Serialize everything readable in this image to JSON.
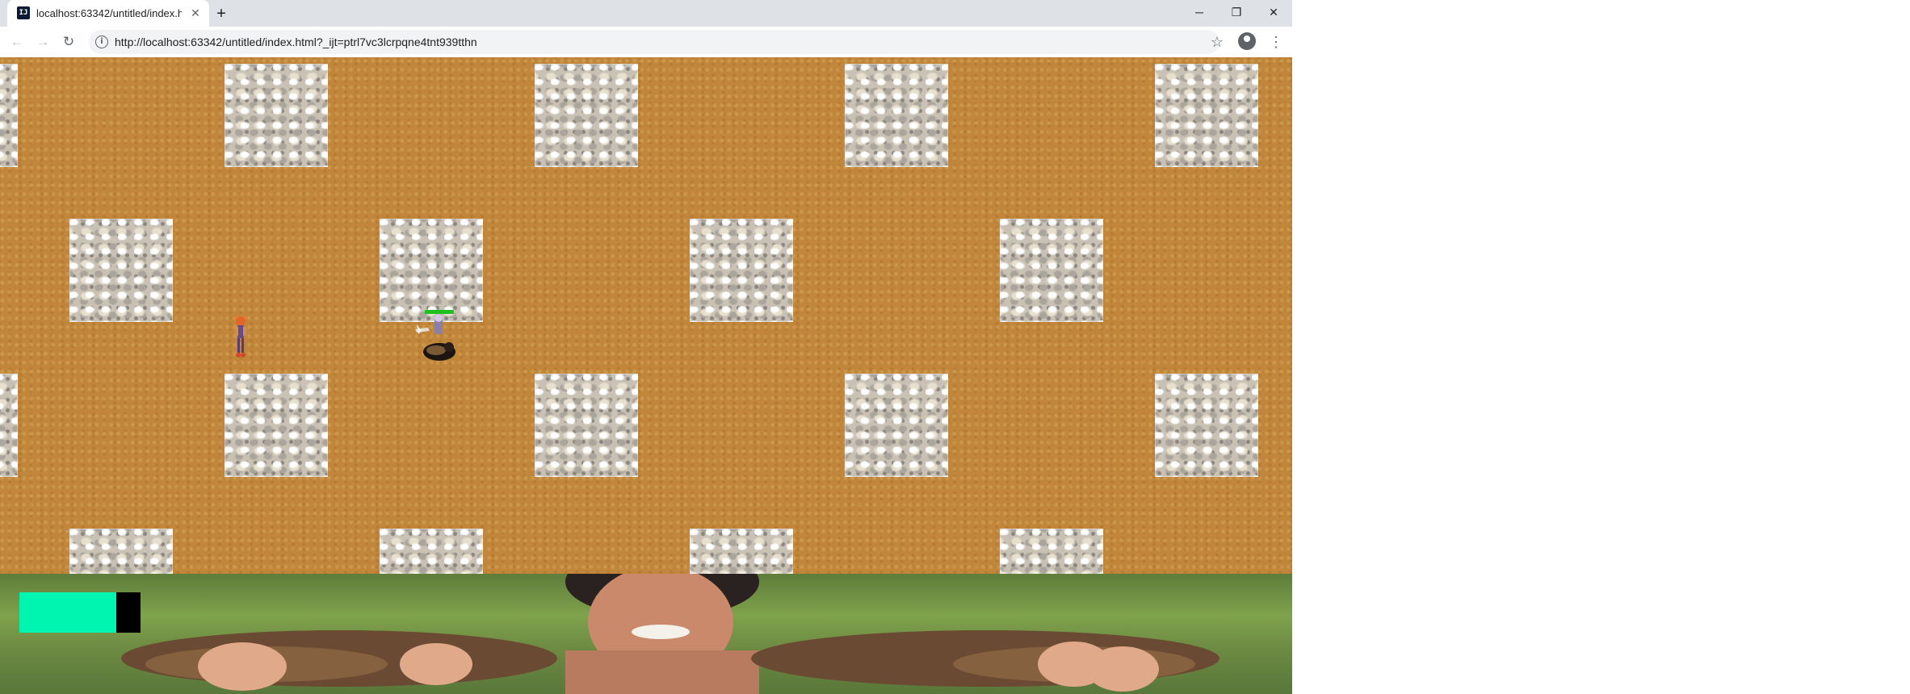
{
  "browser": {
    "tab": {
      "title": "localhost:63342/untitled/index.ht",
      "favicon_icon": "intellij-icon",
      "favicon_text": "IJ"
    },
    "new_tab_label": "+",
    "window_controls": {
      "minimize": "─",
      "restore": "❐",
      "close": "✕"
    },
    "address_bar": {
      "url": "http://localhost:63342/untitled/index.html?_ijt=ptrl7vc3lcrpqne4tnt939tthn",
      "info_icon": "i"
    },
    "icons": {
      "back": "←",
      "forward": "→",
      "reload": "↻",
      "bookmark": "☆",
      "menu": "⋮"
    }
  },
  "game": {
    "background_color": "#c1863a",
    "rock_color": "#c8c1b4",
    "player_health": {
      "fraction": 0.8,
      "fill_color": "#00f5b0"
    },
    "enemy_health": {
      "fraction": 1.0,
      "fill_color": "#20c020"
    }
  }
}
